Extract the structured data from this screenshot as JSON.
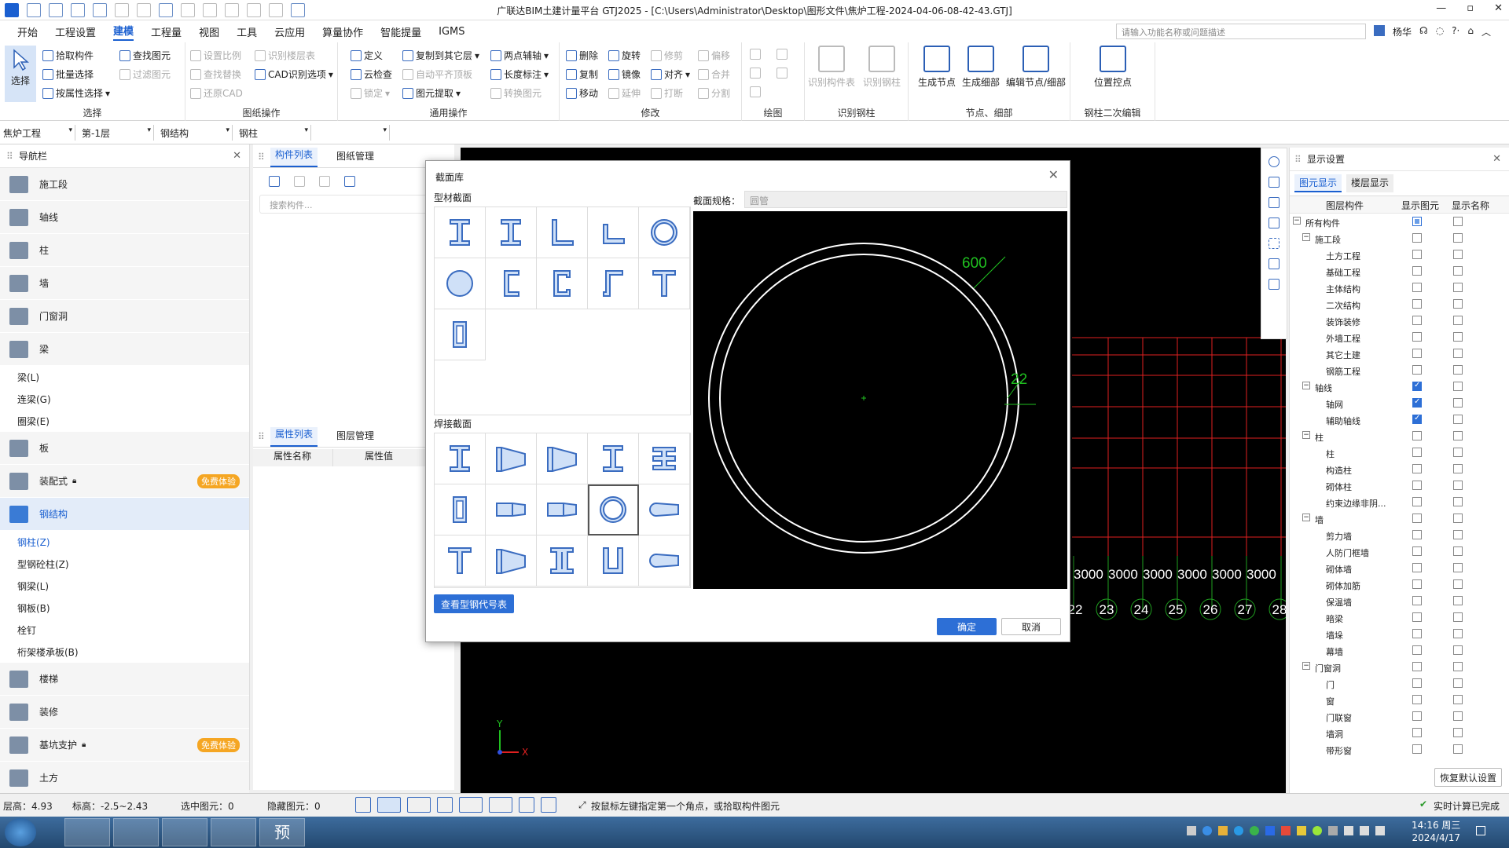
{
  "window": {
    "title": "广联达BIM土建计量平台 GTJ2025 - [C:\\Users\\Administrator\\Desktop\\图形文件\\焦炉工程-2024-04-06-08-42-43.GTJ]",
    "min": "—",
    "restore": "▫",
    "close": "✕"
  },
  "menu": {
    "items": [
      "开始",
      "工程设置",
      "建模",
      "工程量",
      "视图",
      "工具",
      "云应用",
      "算量协作",
      "智能提量",
      "IGMS"
    ],
    "active": 2,
    "search_placeholder": "请输入功能名称或问题描述",
    "user": "杨华"
  },
  "ribbon": {
    "select": {
      "big": "选择",
      "items": [
        "拾取构件",
        "批量选择",
        "按属性选择",
        "查找图元",
        "过滤图元"
      ],
      "label": "选择"
    },
    "drawing": {
      "items": [
        "设置比例",
        "查找替换",
        "还原CAD",
        "识别楼层表",
        "CAD识别选项"
      ],
      "label": "图纸操作"
    },
    "general": {
      "items": [
        "定义",
        "云检查",
        "锁定",
        "复制到其它层",
        "自动平齐顶板",
        "图元提取",
        "两点辅轴",
        "长度标注",
        "转换图元"
      ],
      "label": "通用操作"
    },
    "modify": {
      "items": [
        "删除",
        "复制",
        "移动",
        "旋转",
        "镜像",
        "延伸",
        "修剪",
        "对齐",
        "打断",
        "偏移",
        "合并",
        "分割"
      ],
      "label": "修改"
    },
    "draw": {
      "label": "绘图"
    },
    "recognize": {
      "items": [
        "识别构件表",
        "识别钢柱"
      ],
      "label": "识别钢柱"
    },
    "node": {
      "items": [
        "生成节点",
        "生成细部",
        "编辑节点/细部"
      ],
      "label": "节点、细部"
    },
    "secondary": {
      "items": [
        "位置控点"
      ],
      "label": "钢柱二次编辑"
    }
  },
  "combos": [
    "焦炉工程",
    "第-1层",
    "钢结构",
    "钢柱",
    ""
  ],
  "nav": {
    "title": "导航栏",
    "categories": [
      {
        "label": "施工段"
      },
      {
        "label": "轴线"
      },
      {
        "label": "柱"
      },
      {
        "label": "墙"
      },
      {
        "label": "门窗洞"
      },
      {
        "label": "梁"
      }
    ],
    "beam_subs": [
      "梁(L)",
      "连梁(G)",
      "圈梁(E)"
    ],
    "categories2": [
      {
        "label": "板"
      },
      {
        "label": "装配式",
        "badge": "免费体验"
      },
      {
        "label": "钢结构",
        "selected": true
      }
    ],
    "steel_subs": [
      "钢柱(Z)",
      "型钢砼柱(Z)",
      "钢梁(L)",
      "钢板(B)",
      "栓钉",
      "桁架楼承板(B)"
    ],
    "categories3": [
      {
        "label": "楼梯"
      },
      {
        "label": "装修"
      },
      {
        "label": "基坑支护",
        "badge": "免费体验"
      },
      {
        "label": "土方"
      }
    ]
  },
  "comp": {
    "tabs": [
      "构件列表",
      "图纸管理"
    ],
    "search_placeholder": "搜索构件...",
    "prop_tabs": [
      "属性列表",
      "图层管理"
    ],
    "prop_cols": [
      "属性名称",
      "属性值"
    ]
  },
  "dialog": {
    "title": "截面库",
    "section1": "型材截面",
    "section2": "焊接截面",
    "spec_label": "截面规格：",
    "spec_value": "圆管",
    "dim_outer": "600",
    "dim_thick": "22",
    "view_btn": "查看型钢代号表",
    "ok": "确定",
    "cancel": "取消"
  },
  "canvas": {
    "dims": [
      "3000",
      "3000",
      "3000",
      "3000",
      "3000",
      "3000"
    ],
    "axes": [
      "22",
      "23",
      "24",
      "25",
      "26",
      "27",
      "28"
    ],
    "y": "Y",
    "x": "X"
  },
  "display": {
    "title": "显示设置",
    "tabs": [
      "图元显示",
      "楼层显示"
    ],
    "cols": [
      "图层构件",
      "显示图元",
      "显示名称"
    ],
    "rows": [
      {
        "l": "所有构件",
        "lv": 0,
        "g": true,
        "a": "part",
        "b": "off"
      },
      {
        "l": "施工段",
        "lv": 1,
        "g": true,
        "a": "off",
        "b": "off"
      },
      {
        "l": "土方工程",
        "lv": 2,
        "a": "off",
        "b": "off"
      },
      {
        "l": "基础工程",
        "lv": 2,
        "a": "off",
        "b": "off"
      },
      {
        "l": "主体结构",
        "lv": 2,
        "a": "off",
        "b": "off"
      },
      {
        "l": "二次结构",
        "lv": 2,
        "a": "off",
        "b": "off"
      },
      {
        "l": "装饰装修",
        "lv": 2,
        "a": "off",
        "b": "off"
      },
      {
        "l": "外墙工程",
        "lv": 2,
        "a": "off",
        "b": "off"
      },
      {
        "l": "其它土建",
        "lv": 2,
        "a": "off",
        "b": "off"
      },
      {
        "l": "钢筋工程",
        "lv": 2,
        "a": "off",
        "b": "off"
      },
      {
        "l": "轴线",
        "lv": 1,
        "g": true,
        "a": "on",
        "b": "off"
      },
      {
        "l": "轴网",
        "lv": 2,
        "a": "on",
        "b": "off"
      },
      {
        "l": "辅助轴线",
        "lv": 2,
        "a": "on",
        "b": "off"
      },
      {
        "l": "柱",
        "lv": 1,
        "g": true,
        "a": "off",
        "b": "off"
      },
      {
        "l": "柱",
        "lv": 2,
        "a": "off",
        "b": "off"
      },
      {
        "l": "构造柱",
        "lv": 2,
        "a": "off",
        "b": "off"
      },
      {
        "l": "砌体柱",
        "lv": 2,
        "a": "off",
        "b": "off"
      },
      {
        "l": "约束边缘非阴...",
        "lv": 2,
        "a": "off",
        "b": "off"
      },
      {
        "l": "墙",
        "lv": 1,
        "g": true,
        "a": "off",
        "b": "off"
      },
      {
        "l": "剪力墙",
        "lv": 2,
        "a": "off",
        "b": "off"
      },
      {
        "l": "人防门框墙",
        "lv": 2,
        "a": "off",
        "b": "off"
      },
      {
        "l": "砌体墙",
        "lv": 2,
        "a": "off",
        "b": "off"
      },
      {
        "l": "砌体加筋",
        "lv": 2,
        "a": "off",
        "b": "off"
      },
      {
        "l": "保温墙",
        "lv": 2,
        "a": "off",
        "b": "off"
      },
      {
        "l": "暗梁",
        "lv": 2,
        "a": "off",
        "b": "off"
      },
      {
        "l": "墙垛",
        "lv": 2,
        "a": "off",
        "b": "off"
      },
      {
        "l": "幕墙",
        "lv": 2,
        "a": "off",
        "b": "off"
      },
      {
        "l": "门窗洞",
        "lv": 1,
        "g": true,
        "a": "off",
        "b": "off"
      },
      {
        "l": "门",
        "lv": 2,
        "a": "off",
        "b": "off"
      },
      {
        "l": "窗",
        "lv": 2,
        "a": "off",
        "b": "off"
      },
      {
        "l": "门联窗",
        "lv": 2,
        "a": "off",
        "b": "off"
      },
      {
        "l": "墙洞",
        "lv": 2,
        "a": "off",
        "b": "off"
      },
      {
        "l": "带形窗",
        "lv": 2,
        "a": "off",
        "b": "off"
      }
    ],
    "restore": "恢复默认设置"
  },
  "status": {
    "floor_h": "层高：4.93",
    "elev": "标高：-2.5~2.43",
    "selected": "选中图元：0",
    "hidden": "隐藏图元：0",
    "hint": "按鼠标左键指定第一个角点，或拾取构件图元",
    "calc": "实时计算已完成"
  },
  "taskbar": {
    "apps": [
      "",
      "",
      "",
      "",
      "预"
    ],
    "time": "14:16 周三",
    "date": "2024/4/17"
  }
}
